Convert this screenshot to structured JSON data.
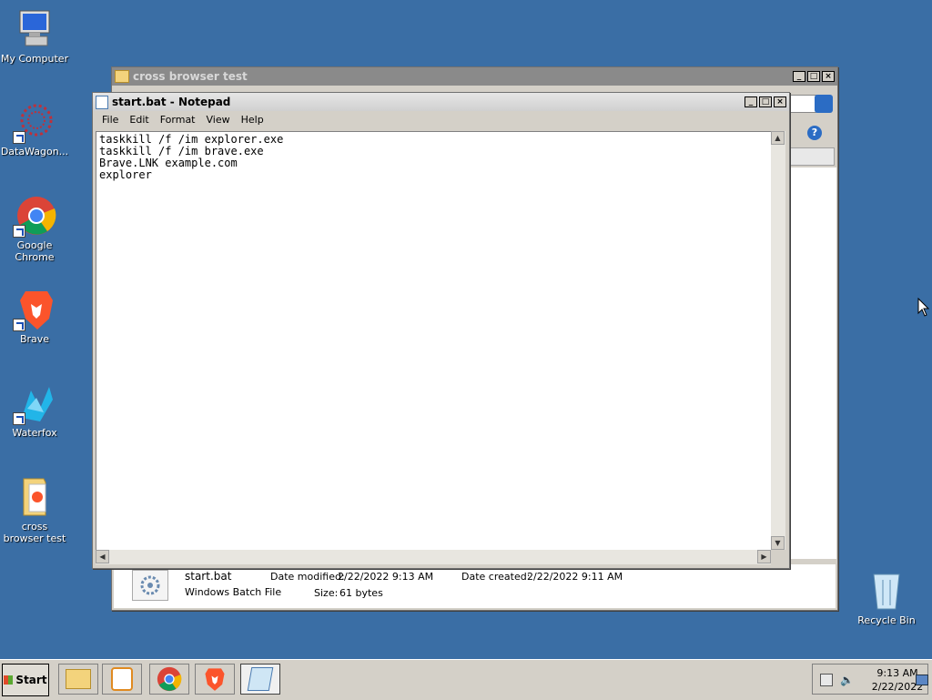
{
  "desktop": {
    "icons": [
      {
        "label": "My Computer"
      },
      {
        "label": "DataWagon..."
      },
      {
        "label": "Google Chrome"
      },
      {
        "label": "Brave"
      },
      {
        "label": "Waterfox"
      },
      {
        "label": "cross browser test"
      },
      {
        "label": "Recycle Bin"
      }
    ]
  },
  "explorer": {
    "title": "cross browser test",
    "details": {
      "name": "start.bat",
      "type": "Windows Batch File",
      "modified_label": "Date modified:",
      "modified_value": "2/22/2022 9:13 AM",
      "created_label": "Date created:",
      "created_value": "2/22/2022 9:11 AM",
      "size_label": "Size:",
      "size_value": "61 bytes"
    }
  },
  "notepad": {
    "title": "start.bat - Notepad",
    "menu": [
      "File",
      "Edit",
      "Format",
      "View",
      "Help"
    ],
    "content": "taskkill /f /im explorer.exe\ntaskkill /f /im brave.exe\nBrave.LNK example.com\nexplorer"
  },
  "taskbar": {
    "start_label": "Start",
    "clock_time": "9:13 AM",
    "clock_date": "2/22/2022"
  }
}
